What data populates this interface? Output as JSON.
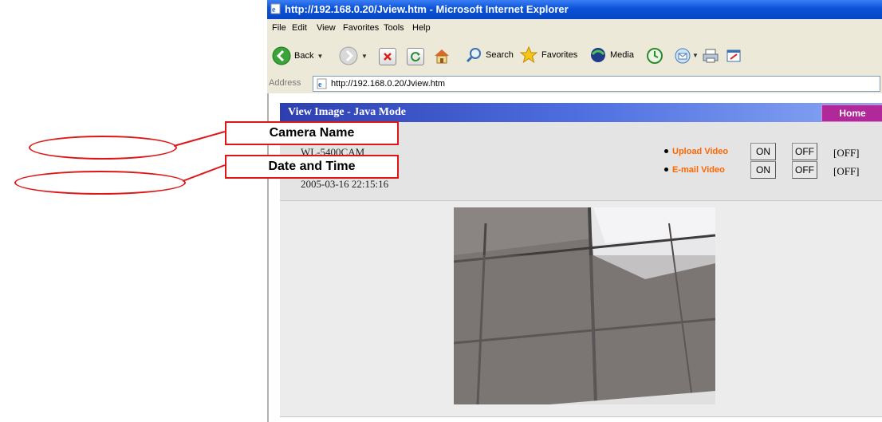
{
  "window": {
    "title": "http://192.168.0.20/Jview.htm - Microsoft Internet Explorer"
  },
  "menu": [
    "File",
    "Edit",
    "View",
    "Favorites",
    "Tools",
    "Help"
  ],
  "toolbar": {
    "back_label": "Back",
    "search_label": "Search",
    "favorites_label": "Favorites",
    "media_label": "Media"
  },
  "address": {
    "label": "Address",
    "url": "http://192.168.0.20/Jview.htm"
  },
  "page": {
    "title": "View Image - Java Mode",
    "home_label": "Home",
    "camera_name": "WL-5400CAM",
    "datetime": "2005-03-16 22:15:16",
    "upload_video": {
      "label": "Upload Video",
      "on": "ON",
      "off": "OFF",
      "state": "[OFF]"
    },
    "email_video": {
      "label": "E-mail Video",
      "on": "ON",
      "off": "OFF",
      "state": "[OFF]"
    }
  },
  "annotations": {
    "camera_name": "Camera Name",
    "date_time": "Date and Time"
  },
  "colors": {
    "title_bar": "#0a52d8",
    "page_bar": "#4f6fe0",
    "home_button": "#b0289a",
    "video_link": "#ff6600",
    "annotation": "#e01515"
  },
  "icons": [
    "ie-page-icon",
    "back-icon",
    "forward-icon",
    "stop-icon",
    "refresh-icon",
    "home-icon",
    "search-icon",
    "favorites-star-icon",
    "media-icon",
    "history-icon",
    "mail-icon",
    "print-icon",
    "edit-icon"
  ]
}
